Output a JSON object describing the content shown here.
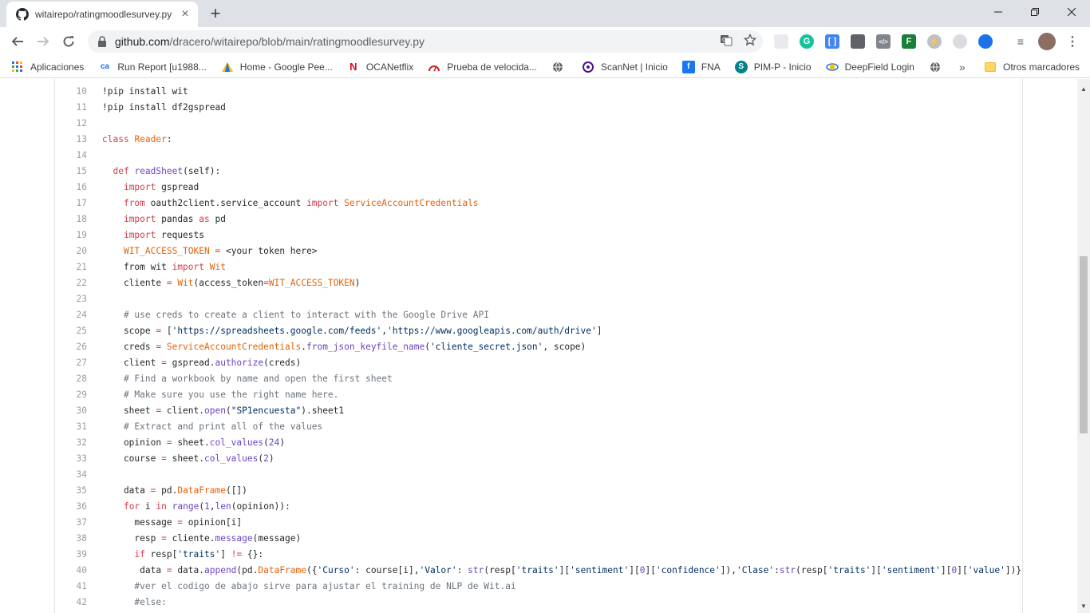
{
  "browser": {
    "tab_title": "witairepo/ratingmoodlesurvey.py",
    "url_host": "github.com",
    "url_path": "/dracero/witairepo/blob/main/ratingmoodlesurvey.py"
  },
  "bookmarks": {
    "items": [
      {
        "label": "Aplicaciones",
        "icon": "apps-grid-icon"
      },
      {
        "label": "Run Report [u1988...",
        "icon": "report-icon"
      },
      {
        "label": "Home - Google Pee...",
        "icon": "people-icon"
      },
      {
        "label": "OCANetflix",
        "icon": "netflix-icon"
      },
      {
        "label": "Prueba de velocida...",
        "icon": "speedtest-icon"
      },
      {
        "label": "",
        "icon": "globe-icon"
      },
      {
        "label": "ScanNet | Inicio",
        "icon": "scannet-icon"
      },
      {
        "label": "FNA",
        "icon": "facebook-icon"
      },
      {
        "label": "PIM-P - Inicio",
        "icon": "sharepoint-icon"
      },
      {
        "label": "DeepField Login",
        "icon": "deepfield-icon"
      },
      {
        "label": "",
        "icon": "globe-icon"
      }
    ],
    "more": "»",
    "other": "Otros marcadores"
  },
  "code": {
    "lines": [
      {
        "num": "10",
        "html": "!pip install wit"
      },
      {
        "num": "11",
        "html": "!pip install df2gspread"
      },
      {
        "num": "12",
        "html": ""
      },
      {
        "num": "13",
        "html": "<span class='k'>class</span> <span class='n'>Reader</span>:"
      },
      {
        "num": "14",
        "html": ""
      },
      {
        "num": "15",
        "html": "  <span class='k'>def</span> <span class='f'>readSheet</span>(self):"
      },
      {
        "num": "16",
        "html": "    <span class='k'>import</span> gspread"
      },
      {
        "num": "17",
        "html": "    <span class='k'>from</span> oauth2client.service_account <span class='k'>import</span> <span class='n'>ServiceAccountCredentials</span>"
      },
      {
        "num": "18",
        "html": "    <span class='k'>import</span> pandas <span class='k'>as</span> pd"
      },
      {
        "num": "19",
        "html": "    <span class='k'>import</span> requests"
      },
      {
        "num": "20",
        "html": "    <span class='n'>WIT_ACCESS_TOKEN</span> <span class='k'>=</span> &lt;your token here&gt;"
      },
      {
        "num": "21",
        "html": "    from wit <span class='k'>import</span> <span class='n'>Wit</span>"
      },
      {
        "num": "22",
        "html": "    cliente <span class='k'>=</span> <span class='n'>Wit</span>(access_token<span class='k'>=</span><span class='n'>WIT_ACCESS_TOKEN</span>)"
      },
      {
        "num": "23",
        "html": ""
      },
      {
        "num": "24",
        "html": "    <span class='c'># use creds to create a client to interact with the Google Drive API</span>"
      },
      {
        "num": "25",
        "html": "    scope <span class='k'>=</span> [<span class='s'>'https://spreadsheets.google.com/feeds'</span>,<span class='s'>'https://www.googleapis.com/auth/drive'</span>]"
      },
      {
        "num": "26",
        "html": "    creds <span class='k'>=</span> <span class='n'>ServiceAccountCredentials</span>.<span class='f'>from_json_keyfile_name</span>(<span class='s'>'cliente_secret.json'</span>, scope)"
      },
      {
        "num": "27",
        "html": "    client <span class='k'>=</span> gspread.<span class='f'>authorize</span>(creds)"
      },
      {
        "num": "28",
        "html": "    <span class='c'># Find a workbook by name and open the first sheet</span>"
      },
      {
        "num": "29",
        "html": "    <span class='c'># Make sure you use the right name here.</span>"
      },
      {
        "num": "30",
        "html": "    sheet <span class='k'>=</span> client.<span class='f'>open</span>(<span class='s'>\"SP1encuesta\"</span>).sheet1"
      },
      {
        "num": "31",
        "html": "    <span class='c'># Extract and print all of the values</span>"
      },
      {
        "num": "32",
        "html": "    opinion <span class='k'>=</span> sheet.<span class='f'>col_values</span>(<span class='f'>24</span>)"
      },
      {
        "num": "33",
        "html": "    course <span class='k'>=</span> sheet.<span class='f'>col_values</span>(<span class='f'>2</span>)"
      },
      {
        "num": "34",
        "html": ""
      },
      {
        "num": "35",
        "html": "    data <span class='k'>=</span> pd.<span class='n'>DataFrame</span>([])"
      },
      {
        "num": "36",
        "html": "    <span class='k'>for</span> i <span class='k'>in</span> <span class='f'>range</span>(<span class='f'>1</span>,<span class='f'>len</span>(opinion)):"
      },
      {
        "num": "37",
        "html": "      message <span class='k'>=</span> opinion[i]"
      },
      {
        "num": "38",
        "html": "      resp <span class='k'>=</span> cliente.<span class='f'>message</span>(message)"
      },
      {
        "num": "39",
        "html": "      <span class='k'>if</span> resp[<span class='s'>'traits'</span>] <span class='k'>!=</span> {}:"
      },
      {
        "num": "40",
        "html": "       data <span class='k'>=</span> data.<span class='f'>append</span>(pd.<span class='n'>DataFrame</span>({<span class='s'>'Curso'</span>: course[i],<span class='s'>'Valor'</span>: <span class='f'>str</span>(resp[<span class='s'>'traits'</span>][<span class='s'>'sentiment'</span>][<span class='f'>0</span>][<span class='s'>'confidence'</span>]),<span class='s'>'Clase'</span>:<span class='f'>str</span>(resp[<span class='s'>'traits'</span>][<span class='s'>'sentiment'</span>][<span class='f'>0</span>][<span class='s'>'value'</span>])}, in"
      },
      {
        "num": "41",
        "html": "      <span class='c'>#ver el codigo de abajo sirve para ajustar el training de NLP de Wit.ai</span>"
      },
      {
        "num": "42",
        "html": "      <span class='c'>#else:</span>"
      }
    ]
  },
  "colors": {
    "keyword": "#d73a49",
    "name": "#e36209",
    "function": "#6f42c1",
    "comment": "#6a737d",
    "string": "#032f62"
  }
}
